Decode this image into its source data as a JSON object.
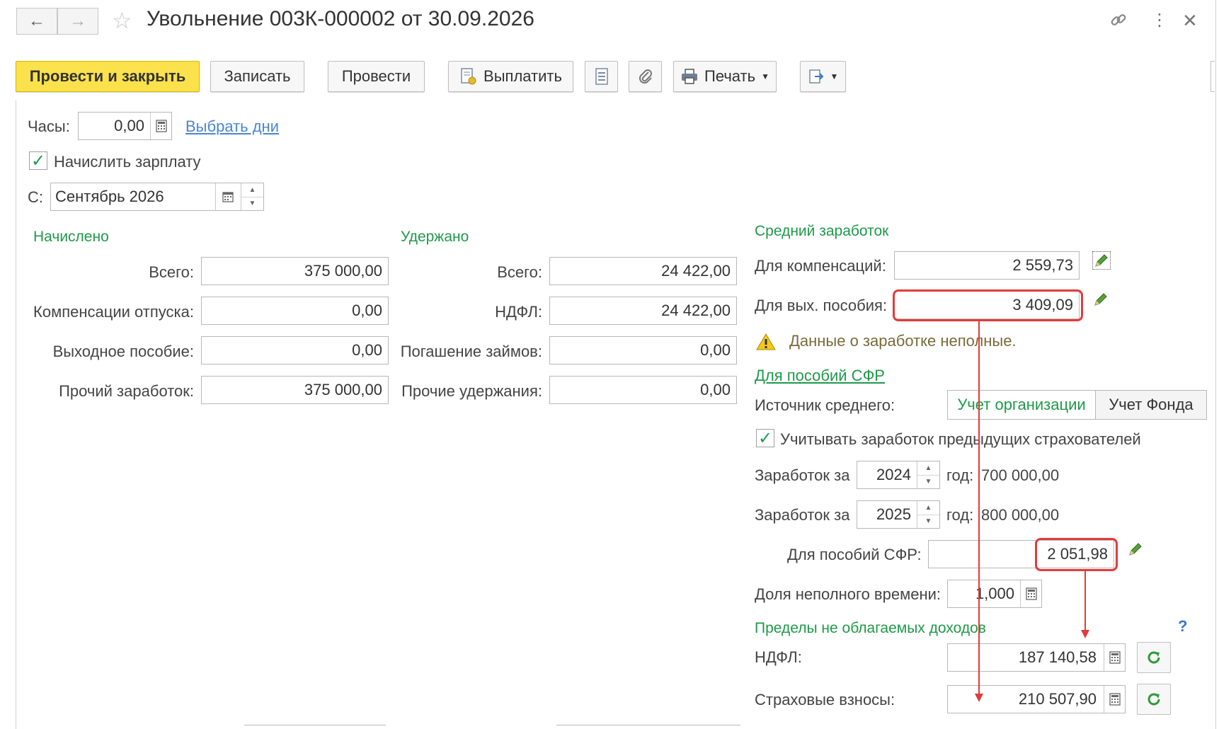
{
  "header": {
    "title": "Увольнение 003К-000002 от 30.09.2026",
    "back_icon": "←",
    "forward_icon": "→"
  },
  "toolbar": {
    "post_close": "Провести и закрыть",
    "save": "Записать",
    "post": "Провести",
    "pay": "Выплатить",
    "print": "Печать"
  },
  "hours": {
    "label": "Часы:",
    "value": "0,00",
    "choose_days": "Выбрать дни"
  },
  "accrue_salary": {
    "label": "Начислить зарплату",
    "checked": true
  },
  "from": {
    "label": "С:",
    "value": "Сентябрь 2026"
  },
  "accrued": {
    "title": "Начислено",
    "rows": [
      {
        "label": "Всего:",
        "value": "375 000,00"
      },
      {
        "label": "Компенсации отпуска:",
        "value": "0,00"
      },
      {
        "label": "Выходное пособие:",
        "value": "0,00"
      },
      {
        "label": "Прочий заработок:",
        "value": "375 000,00"
      }
    ]
  },
  "withheld": {
    "title": "Удержано",
    "rows": [
      {
        "label": "Всего:",
        "value": "24 422,00"
      },
      {
        "label": "НДФЛ:",
        "value": "24 422,00"
      },
      {
        "label": "Погашение займов:",
        "value": "0,00"
      },
      {
        "label": "Прочие удержания:",
        "value": "0,00"
      }
    ]
  },
  "avg": {
    "title": "Средний заработок",
    "compensation_label": "Для компенсаций:",
    "compensation_value": "2 559,73",
    "severance_label": "Для вых. пособия:",
    "severance_value": "3 409,09",
    "warning": "Данные о заработке неполные.",
    "sfr_link": "Для пособий СФР",
    "source_label": "Источник среднего:",
    "source_org": "Учет организации",
    "source_fund": "Учет Фонда",
    "prev_insurers_label": "Учитывать заработок предыдущих страхователей",
    "earnings_label": "Заработок за",
    "year_label": "год:",
    "year1": "2024",
    "year1_sum": "700 000,00",
    "year2": "2025",
    "year2_sum": "800 000,00",
    "sfr_label": "Для пособий СФР:",
    "sfr_value": "2 051,98",
    "part_time_label": "Доля неполного времени:",
    "part_time_value": "1,000"
  },
  "limits": {
    "title": "Пределы не облагаемых доходов",
    "help": "?",
    "ndfl_label": "НДФЛ:",
    "ndfl_value": "187 140,58",
    "insurance_label": "Страховые взносы:",
    "insurance_value": "210 507,90"
  },
  "colors": {
    "accent_green": "#1f9a4a",
    "highlight_red": "#e23b3b",
    "primary_button": "#fbe14b",
    "link_blue": "#4a86d4"
  }
}
